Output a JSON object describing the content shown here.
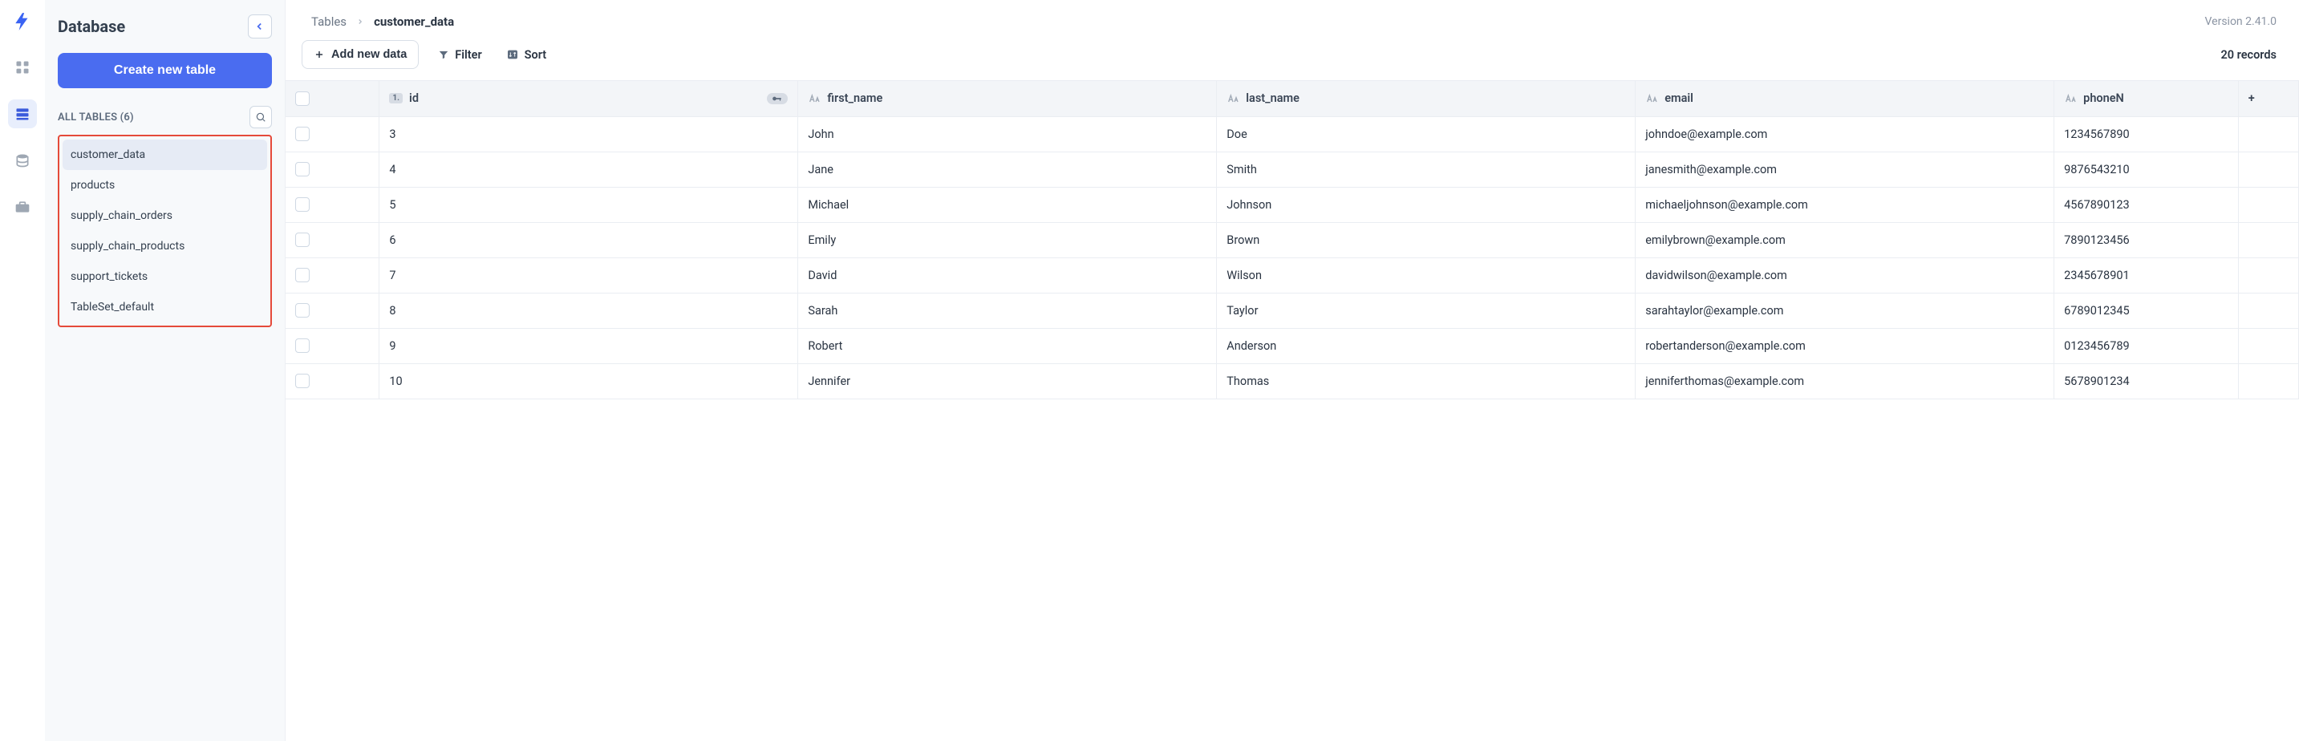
{
  "sidebar": {
    "title": "Database",
    "create_label": "Create new table",
    "all_tables_label": "ALL TABLES (6)",
    "tables": [
      {
        "name": "customer_data",
        "active": true
      },
      {
        "name": "products",
        "active": false
      },
      {
        "name": "supply_chain_orders",
        "active": false
      },
      {
        "name": "supply_chain_products",
        "active": false
      },
      {
        "name": "support_tickets",
        "active": false
      },
      {
        "name": "TableSet_default",
        "active": false
      }
    ]
  },
  "header": {
    "breadcrumb_root": "Tables",
    "breadcrumb_current": "customer_data",
    "version": "Version 2.41.0"
  },
  "toolbar": {
    "add_data_label": "Add new data",
    "filter_label": "Filter",
    "sort_label": "Sort",
    "record_count": "20 records"
  },
  "columns": {
    "id": "id",
    "first_name": "first_name",
    "last_name": "last_name",
    "email": "email",
    "phone": "phoneN"
  },
  "rows": [
    {
      "id": "3",
      "first_name": "John",
      "last_name": "Doe",
      "email": "johndoe@example.com",
      "phone": "1234567890"
    },
    {
      "id": "4",
      "first_name": "Jane",
      "last_name": "Smith",
      "email": "janesmith@example.com",
      "phone": "9876543210"
    },
    {
      "id": "5",
      "first_name": "Michael",
      "last_name": "Johnson",
      "email": "michaeljohnson@example.com",
      "phone": "4567890123"
    },
    {
      "id": "6",
      "first_name": "Emily",
      "last_name": "Brown",
      "email": "emilybrown@example.com",
      "phone": "7890123456"
    },
    {
      "id": "7",
      "first_name": "David",
      "last_name": "Wilson",
      "email": "davidwilson@example.com",
      "phone": "2345678901"
    },
    {
      "id": "8",
      "first_name": "Sarah",
      "last_name": "Taylor",
      "email": "sarahtaylor@example.com",
      "phone": "6789012345"
    },
    {
      "id": "9",
      "first_name": "Robert",
      "last_name": "Anderson",
      "email": "robertanderson@example.com",
      "phone": "0123456789"
    },
    {
      "id": "10",
      "first_name": "Jennifer",
      "last_name": "Thomas",
      "email": "jenniferthomas@example.com",
      "phone": "5678901234"
    }
  ]
}
